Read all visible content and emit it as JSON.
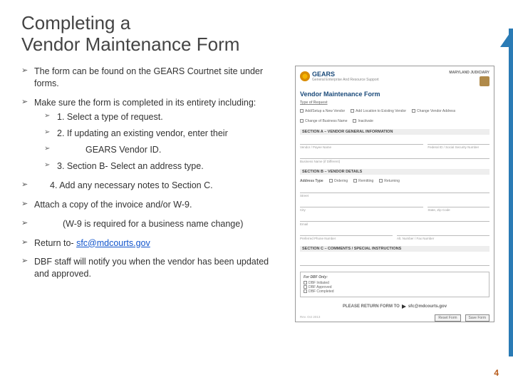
{
  "title": "Completing a\nVendor Maintenance Form",
  "bullets": {
    "b1": "The form can be found on the GEARS Courtnet site under forms.",
    "b2": "Make sure the form is completed in its entirety including:",
    "b2_1": "1. Select a type of request.",
    "b2_2": "2. If updating an existing vendor, enter their",
    "b2_2b": "GEARS Vendor ID.",
    "b2_3": "3. Section B- Select an address type.",
    "b2_4": "4. Add any necessary notes to Section C.",
    "b3": "Attach a copy of the invoice and/or W-9.",
    "b3b": "(W-9 is required for a business name change)",
    "b4_pre": "Return to- ",
    "b4_link": "sfc@mdcourts.gov",
    "b5": "DBF staff will notify you when the vendor has been updated and approved."
  },
  "page_number": "4",
  "form": {
    "brand": "GEARS",
    "brand_sub": "General Enterprise And Resource Support",
    "org": "MARYLAND JUDICIARY",
    "title": "Vendor Maintenance Form",
    "type_label": "Type of Request",
    "req1": "Add/Setup a New Vendor",
    "req2": "Change Vendor Address",
    "req3": "Add Location to Existing Vendor",
    "req4": "Change of Business Name",
    "req5": "Inactivate",
    "secA": "SECTION A – VENDOR GENERAL INFORMATION",
    "fA1": "Vendor / Payee Name",
    "fA2": "Federal ID / Social Security Number",
    "fA3": "Business Name (if Different)",
    "secB": "SECTION B – VENDOR DETAILS",
    "bHdr": "Address Type",
    "bOpt1": "Ordering",
    "bOpt2": "Remitting",
    "bOpt3": "Returning",
    "fB1": "Street",
    "fB2": "City",
    "fB3": "State, Zip Code",
    "fB4": "Email",
    "fB5": "Preferred Phone Number",
    "fB6": "Alt. Number / Fax Number",
    "secC": "SECTION C – COMMENTS / SPECIAL INSTRUCTIONS",
    "dbf": "For DBF Only:",
    "d1": "DBF Initiated",
    "d2": "DBF Approved",
    "d3": "DBF Completed",
    "return": "PLEASE RETURN FORM TO",
    "return_email": "sfc@mdcourts.gov",
    "btn1": "Reset Form",
    "btn2": "Save Form",
    "rev": "Rev. Oct 2013"
  }
}
